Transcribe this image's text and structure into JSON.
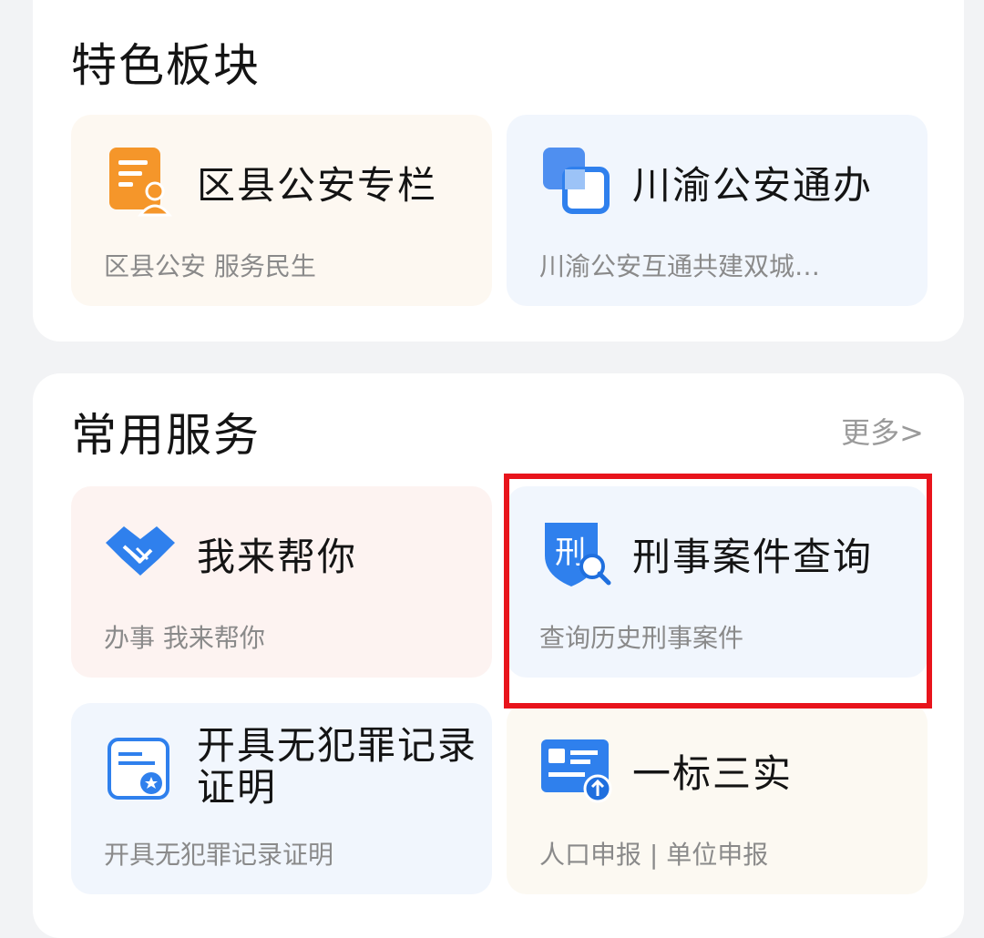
{
  "featured": {
    "title": "特色板块",
    "cards": [
      {
        "title": "区县公安专栏",
        "subtitle": "区县公安 服务民生",
        "icon": "district-police-document-icon"
      },
      {
        "title": "川渝公安通办",
        "subtitle": "川渝公安互通共建双城…",
        "icon": "overlapping-squares-icon"
      }
    ]
  },
  "common": {
    "title": "常用服务",
    "more": "更多>",
    "cards": [
      {
        "title": "我来帮你",
        "subtitle": "办事 我来帮你",
        "icon": "handshake-icon"
      },
      {
        "title": "刑事案件查询",
        "subtitle": "查询历史刑事案件",
        "icon": "criminal-shield-search-icon"
      },
      {
        "title": "开具无犯罪记录证明",
        "subtitle": "开具无犯罪记录证明",
        "icon": "certificate-icon"
      },
      {
        "title": "一标三实",
        "subtitle": "人口申报 | 单位申报",
        "icon": "id-card-upload-icon"
      }
    ]
  },
  "colors": {
    "highlight": "#e8141c",
    "orange_icon": "#f5962a",
    "blue_icon": "#2f80ed"
  }
}
